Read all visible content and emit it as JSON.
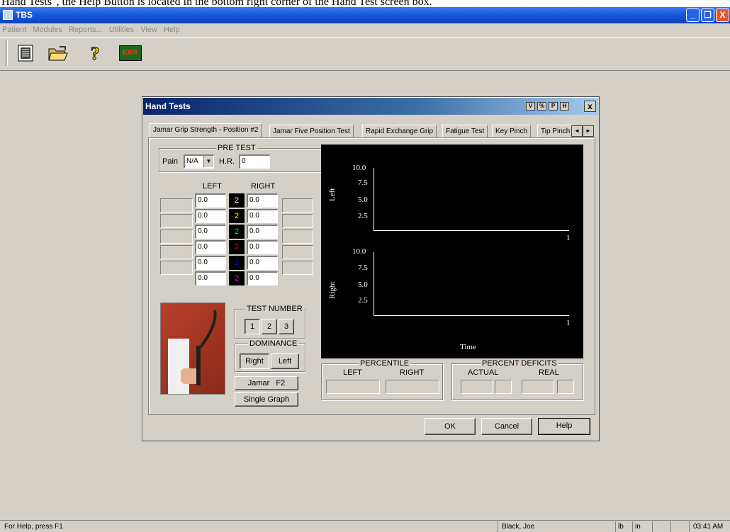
{
  "caption": "Hand Tests\", the Help Button is located in the bottom right corner of the Hand Test screen box.",
  "app": {
    "title": "TBS"
  },
  "window_controls": {
    "minimize": "_",
    "restore": "❐",
    "close": "X"
  },
  "menu": [
    "Patient",
    "Modules",
    "Reports...",
    "Utilities",
    "View",
    "Help"
  ],
  "toolbar": {
    "exit_label": "EXIT",
    "help_glyph": "?"
  },
  "dialog": {
    "title": "Hand Tests",
    "mini_buttons": [
      "V",
      "%",
      "P",
      "H"
    ],
    "close": "x",
    "tabs": [
      "Jamar Grip Strength - Position #2",
      "Jamar Five Position Test",
      "Rapid Exchange Grip",
      "Fatigue Test",
      "Key Pinch",
      "Tip Pinch"
    ],
    "tab_arrows": [
      "◄",
      "►"
    ],
    "pretest": {
      "legend": "PRE TEST",
      "pain_label": "Pain",
      "pain_value": "N/A",
      "hr_label": "H.R.",
      "hr_value": "0"
    },
    "grid": {
      "left_header": "LEFT",
      "right_header": "RIGHT",
      "rows": [
        {
          "left": "0.0",
          "mid": "2",
          "right": "0.0",
          "color": "#ffffff"
        },
        {
          "left": "0.0",
          "mid": "2",
          "right": "0.0",
          "color": "#ffff00"
        },
        {
          "left": "0.0",
          "mid": "2",
          "right": "0.0",
          "color": "#00ff00"
        },
        {
          "left": "0.0",
          "mid": "2",
          "right": "0.0",
          "color": "#ff0000"
        },
        {
          "left": "0.0",
          "mid": "2",
          "right": "0.0",
          "color": "#0000ff"
        },
        {
          "left": "0.0",
          "mid": "2",
          "right": "0.0",
          "color": "#ff00ff"
        }
      ]
    },
    "test_number": {
      "legend": "TEST NUMBER",
      "options": [
        "1",
        "2",
        "3"
      ],
      "selected": "1"
    },
    "dominance": {
      "legend": "DOMINANCE",
      "options": [
        "Right",
        "Left"
      ],
      "selected": "Right"
    },
    "jamar_button": "Jamar   F2",
    "single_graph_button": "Single Graph",
    "graph": {
      "top_label": "Left",
      "bottom_label": "Right",
      "x_label": "Time",
      "y_ticks": [
        "10.0",
        "7.5",
        "5.0",
        "2.5"
      ],
      "x_end": "1"
    },
    "percentile": {
      "legend": "PERCENTILE",
      "left": "LEFT",
      "right": "RIGHT"
    },
    "deficits": {
      "legend": "PERCENT DEFICITS",
      "actual": "ACTUAL",
      "real": "REAL"
    },
    "buttons": {
      "ok": "OK",
      "cancel": "Cancel",
      "help": "Help"
    }
  },
  "status": {
    "hint": "For Help, press F1",
    "user": "Black, Joe",
    "unit1": "lb",
    "unit2": "in",
    "time": "03:41 AM"
  }
}
